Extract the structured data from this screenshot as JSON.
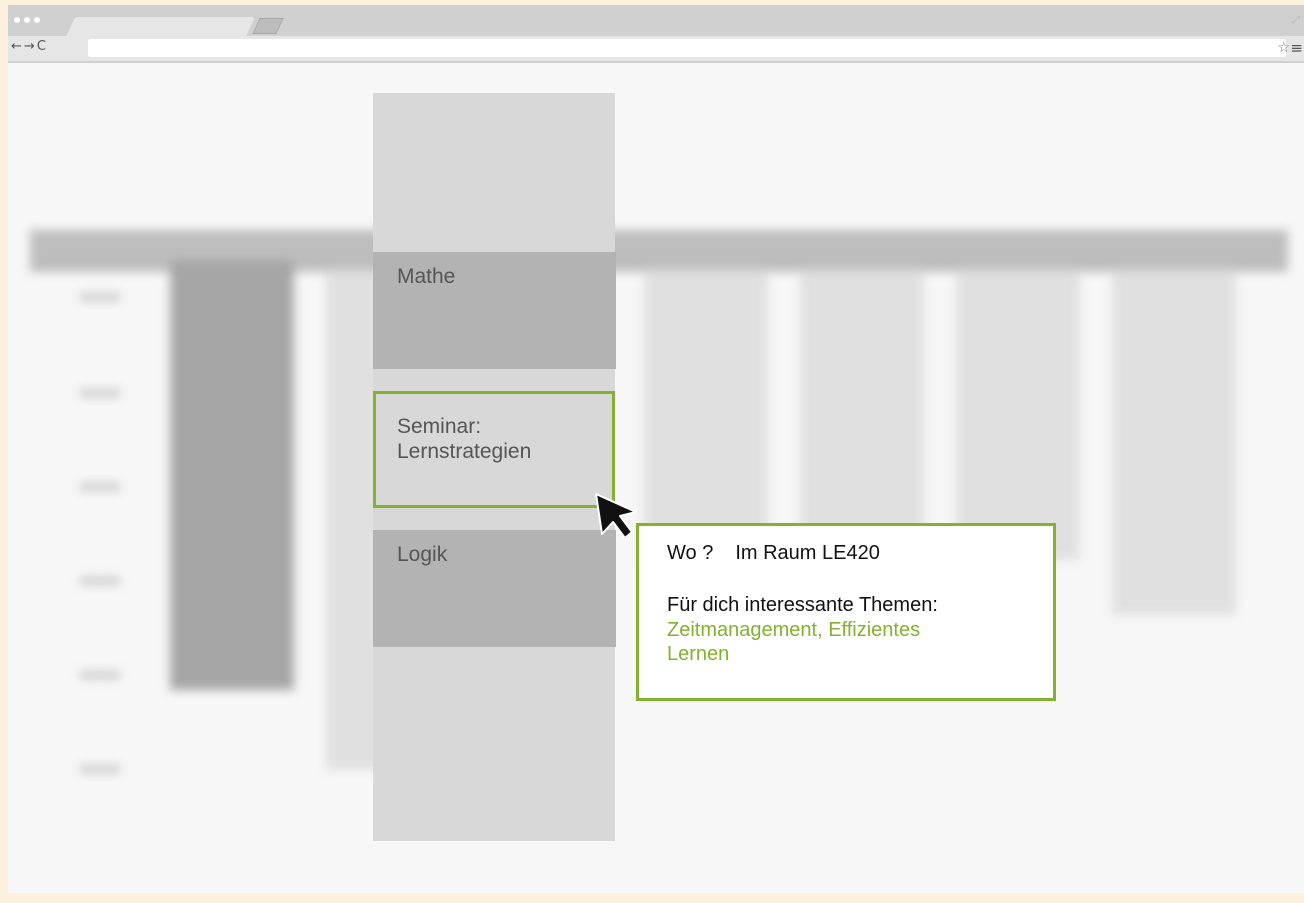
{
  "browser": {
    "url": "",
    "icons": [
      "back-arrow-icon",
      "forward-arrow-icon",
      "reload-icon",
      "star-icon",
      "menu-icon"
    ]
  },
  "day_column": {
    "blocks": [
      {
        "label": "Mathe"
      },
      {
        "label_line1": "Seminar:",
        "label_line2": "Lernstrategien"
      },
      {
        "label": "Logik"
      }
    ]
  },
  "tooltip": {
    "where_label": "Wo ?",
    "where_value": "Im Raum LE420",
    "topics_heading": "Für dich interessante Themen:",
    "topics_line1": "Zeitmanagement,  Effizientes",
    "topics_line2": "Lernen"
  },
  "colors": {
    "accent": "#84b130",
    "block_dark": "#b3b3b3",
    "block_light": "#d8d8d8",
    "page_bg": "#fdf0dc"
  }
}
